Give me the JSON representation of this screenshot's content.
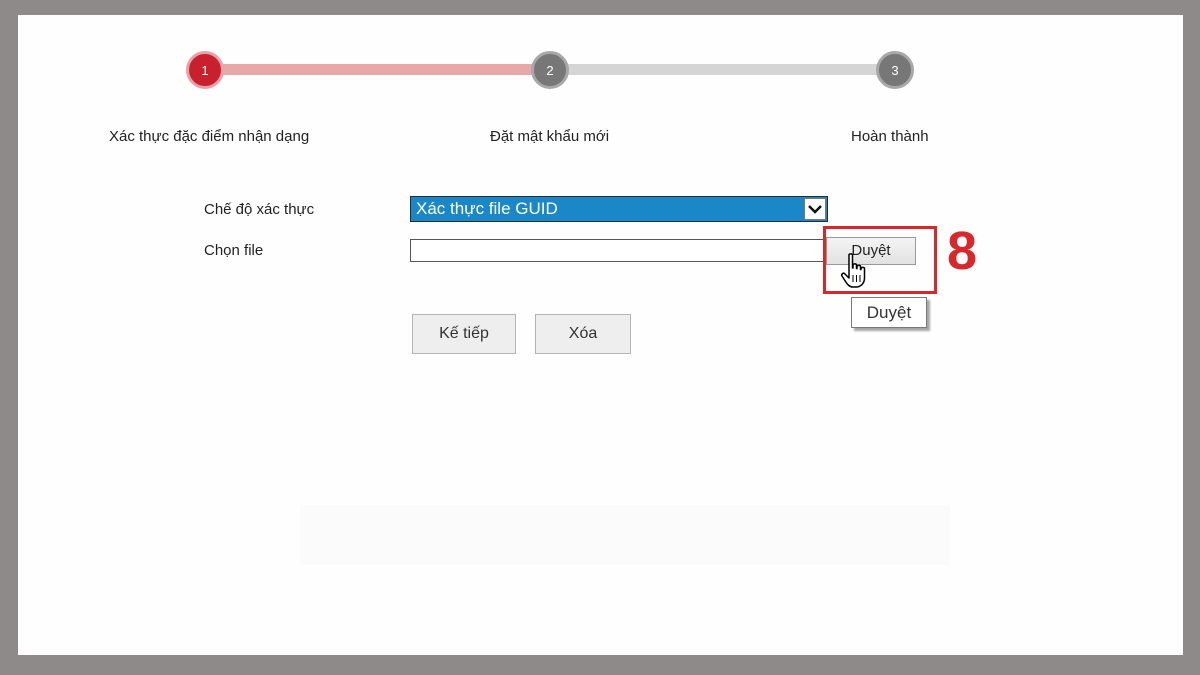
{
  "stepper": {
    "steps": [
      {
        "number": "1",
        "label": "Xác thực đặc điểm nhận dạng",
        "state": "active"
      },
      {
        "number": "2",
        "label": "Đặt mật khẩu mới",
        "state": "pending"
      },
      {
        "number": "3",
        "label": "Hoàn thành",
        "state": "pending"
      }
    ]
  },
  "form": {
    "auth_mode_label": "Chế độ xác thực",
    "auth_mode_value": "Xác thực file GUID",
    "file_label": "Chọn file",
    "file_value": "",
    "browse_label": "Duyệt",
    "browse_tooltip": "Duyệt"
  },
  "actions": {
    "next_label": "Kế tiếp",
    "clear_label": "Xóa"
  },
  "annotation": {
    "step_number": "8",
    "color": "#d9282b"
  },
  "colors": {
    "active_step": "#c9202e",
    "progress_done": "#e8a8a8",
    "progress_pending": "#d5d5d5",
    "select_bg": "#1a87c9"
  },
  "icons": {
    "select_arrow": "chevron-down-icon",
    "cursor": "hand-pointer-icon"
  }
}
